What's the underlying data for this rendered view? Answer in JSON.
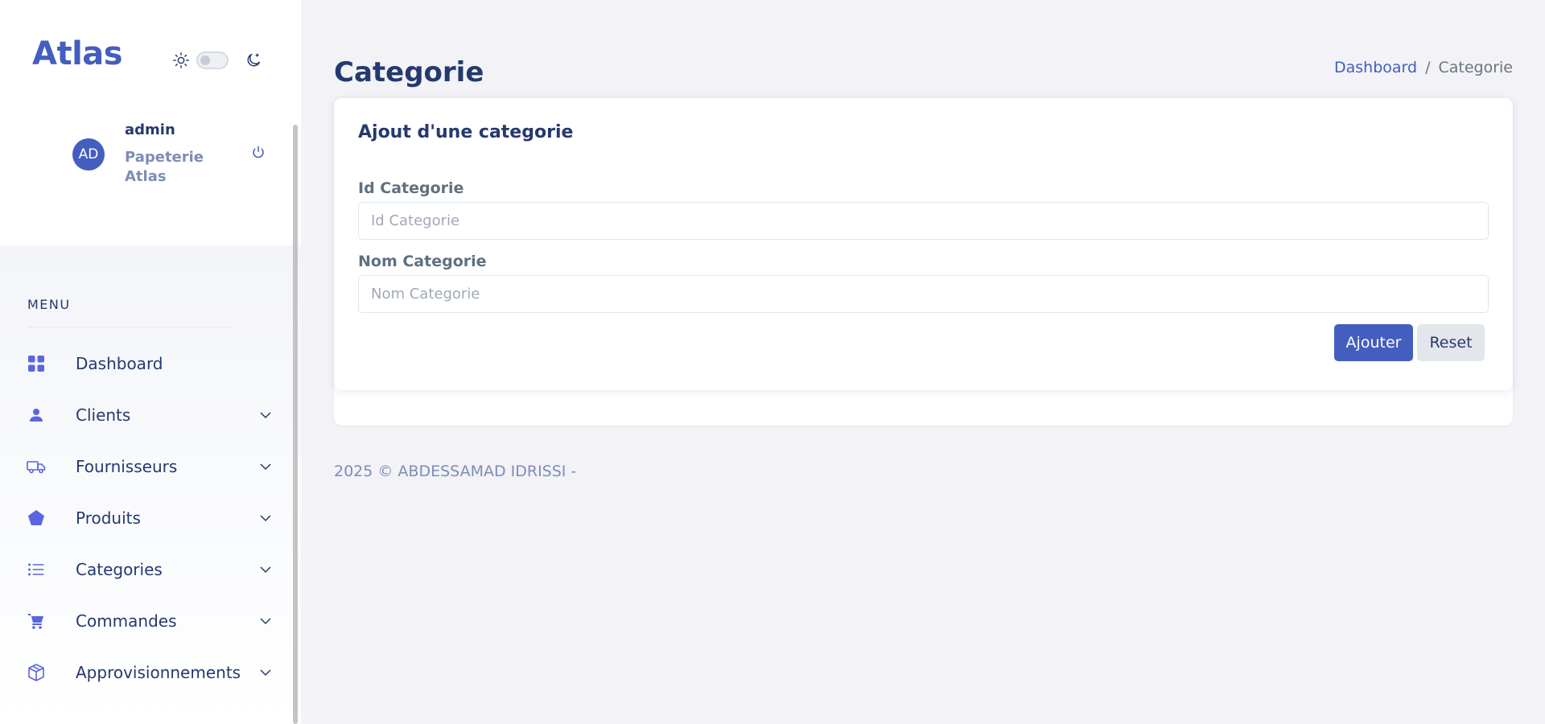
{
  "app": {
    "brand": "Atlas"
  },
  "user": {
    "initials": "AD",
    "name": "admin",
    "company": "Papeterie Atlas"
  },
  "sidebar": {
    "menu_title": "MENU",
    "items": [
      {
        "label": "Dashboard",
        "icon": "grid-icon",
        "has_submenu": false
      },
      {
        "label": "Clients",
        "icon": "person-icon",
        "has_submenu": true
      },
      {
        "label": "Fournisseurs",
        "icon": "truck-icon",
        "has_submenu": true
      },
      {
        "label": "Produits",
        "icon": "pentagon-icon",
        "has_submenu": true
      },
      {
        "label": "Categories",
        "icon": "list-icon",
        "has_submenu": true
      },
      {
        "label": "Commandes",
        "icon": "cart-icon",
        "has_submenu": true
      },
      {
        "label": "Approvisionnements",
        "icon": "box-icon",
        "has_submenu": true
      }
    ]
  },
  "header": {
    "title": "Categorie",
    "breadcrumb": {
      "home": "Dashboard",
      "separator": "/",
      "current": "Categorie"
    }
  },
  "form": {
    "title": "Ajout d'une categorie",
    "id_label": "Id Categorie",
    "id_placeholder": "Id Categorie",
    "id_value": "",
    "name_label": "Nom Categorie",
    "name_placeholder": "Nom Categorie",
    "name_value": "",
    "submit_label": "Ajouter",
    "reset_label": "Reset"
  },
  "footer": {
    "text": "2025 © ABDESSAMAD IDRISSI -"
  },
  "colors": {
    "accent": "#435ebe",
    "text_dark": "#25396f",
    "text_muted": "#7c8db5",
    "page_bg": "#f2f2f7",
    "icon_purple": "#6a73e8"
  }
}
